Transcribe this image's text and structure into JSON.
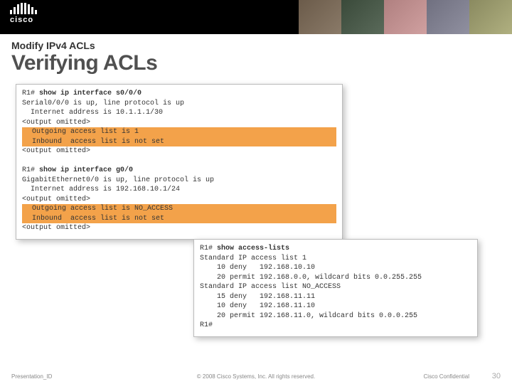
{
  "logo_text": "cisco",
  "subtitle": "Modify IPv4 ACLs",
  "title": "Verifying ACLs",
  "term1": {
    "l1_prompt": "R1# ",
    "l1_cmd": "show ip interface s0/0/0",
    "l2": "Serial0/0/0 is up, line protocol is up",
    "l3": "  Internet address is 10.1.1.1/30",
    "l4": "<output omitted>",
    "l5": "  Outgoing access list is 1",
    "l6": "  Inbound  access list is not set",
    "l7": "<output omitted>",
    "l8_blank": " ",
    "l9_prompt": "R1# ",
    "l9_cmd": "show ip interface g0/0",
    "l10": "GigabitEthernet0/0 is up, line protocol is up",
    "l11": "  Internet address is 192.168.10.1/24",
    "l12": "<output omitted>",
    "l13": "  Outgoing access list is NO_ACCESS",
    "l14": "  Inbound  access list is not set",
    "l15": "<output omitted>"
  },
  "term2": {
    "l1_prompt": "R1# ",
    "l1_cmd": "show access-lists",
    "l2": "Standard IP access list 1",
    "l3": "    10 deny   192.168.10.10",
    "l4": "    20 permit 192.168.0.0, wildcard bits 0.0.255.255",
    "l5": "Standard IP access list NO_ACCESS",
    "l6": "    15 deny   192.168.11.11",
    "l7": "    10 deny   192.168.11.10",
    "l8": "    20 permit 192.168.11.0, wildcard bits 0.0.0.255",
    "l9": "R1#"
  },
  "footer": {
    "pid": "Presentation_ID",
    "copy": "© 2008 Cisco Systems, Inc. All rights reserved.",
    "conf": "Cisco Confidential",
    "page": "30"
  }
}
